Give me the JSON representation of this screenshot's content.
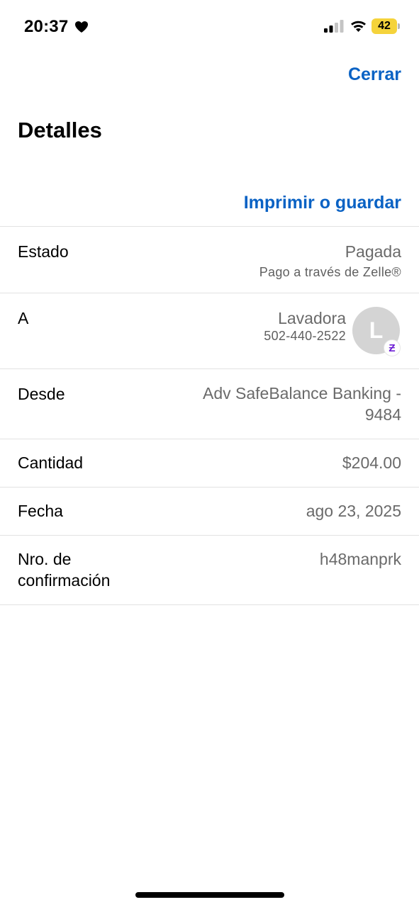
{
  "status_bar": {
    "time": "20:37",
    "battery_level": "42",
    "icons": [
      "heart-icon",
      "signal-icon",
      "wifi-icon",
      "battery-icon"
    ],
    "battery_color": "#f5d33b"
  },
  "header": {
    "close_label": "Cerrar",
    "title": "Detalles",
    "print_label": "Imprimir o guardar"
  },
  "details": {
    "estado": {
      "label": "Estado",
      "value": "Pagada",
      "sub": "Pago a través de Zelle®"
    },
    "a": {
      "label": "A",
      "value": "Lavadora",
      "sub": "502-440-2522",
      "avatar_initial": "L",
      "badge_icon": "zelle-icon",
      "badge_glyph": "Ƶ"
    },
    "desde": {
      "label": "Desde",
      "value": "Adv SafeBalance Banking - 9484"
    },
    "cantidad": {
      "label": "Cantidad",
      "value": "$204.00"
    },
    "fecha": {
      "label": "Fecha",
      "value": "ago 23, 2025"
    },
    "confirmacion": {
      "label": "Nro. de confirmación",
      "value": "h48manprk"
    }
  },
  "colors": {
    "link": "#0a62c4",
    "value_text": "#6a6a6a",
    "zelle_purple": "#6d1ed4"
  }
}
